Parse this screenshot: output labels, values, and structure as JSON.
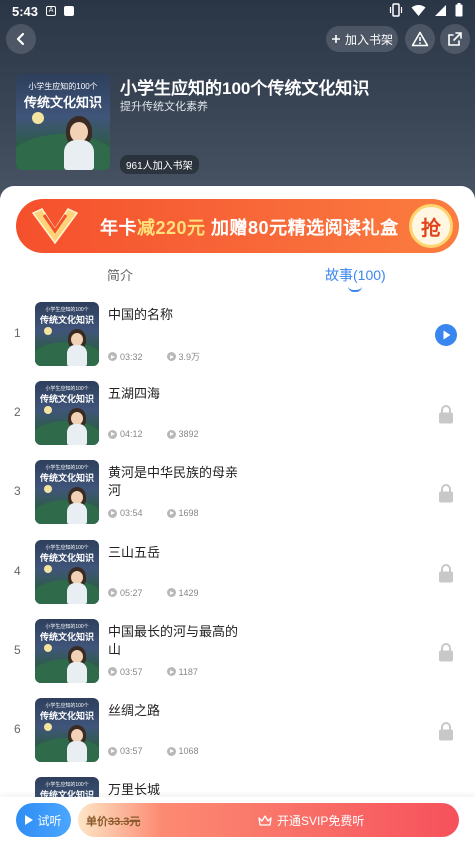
{
  "status_bar": {
    "time": "5:43",
    "icon_a": "A"
  },
  "header": {
    "add_shelf_label": "加入书架",
    "book_title": "小学生应知的100个传统文化知识",
    "book_subtitle": "提升传统文化素养",
    "shelf_count": "961人加入书架",
    "cover_line1": "小学生应知的100个",
    "cover_line2": "传统文化知识"
  },
  "banner": {
    "prefix": "年卡",
    "highlight": "减220元",
    "suffix": " 加赠80元精选阅读礼盒",
    "grab_label": "抢"
  },
  "tabs": {
    "intro": "简介",
    "stories": "故事(100)"
  },
  "episodes": [
    {
      "num": "1",
      "title": "中国的名称",
      "duration": "03:32",
      "plays": "3.9万",
      "status": "playing"
    },
    {
      "num": "2",
      "title": "五湖四海",
      "duration": "04:12",
      "plays": "3892",
      "status": "locked"
    },
    {
      "num": "3",
      "title": "黄河是中华民族的母亲河",
      "duration": "03:54",
      "plays": "1698",
      "status": "locked"
    },
    {
      "num": "4",
      "title": "三山五岳",
      "duration": "05:27",
      "plays": "1429",
      "status": "locked"
    },
    {
      "num": "5",
      "title": "中国最长的河与最高的山",
      "duration": "03:57",
      "plays": "1187",
      "status": "locked"
    },
    {
      "num": "6",
      "title": "丝绸之路",
      "duration": "03:57",
      "plays": "1068",
      "status": "locked"
    },
    {
      "num": "7",
      "title": "万里长城",
      "duration": "",
      "plays": "",
      "status": "locked"
    }
  ],
  "bottom": {
    "listen_label": "试听",
    "price_prefix": "单价",
    "price_value": "33.3元",
    "vip_label": "开通SVIP免费听"
  },
  "colors": {
    "accent": "#3a86f0",
    "banner": "#f5502c",
    "header": "#2a3646"
  }
}
